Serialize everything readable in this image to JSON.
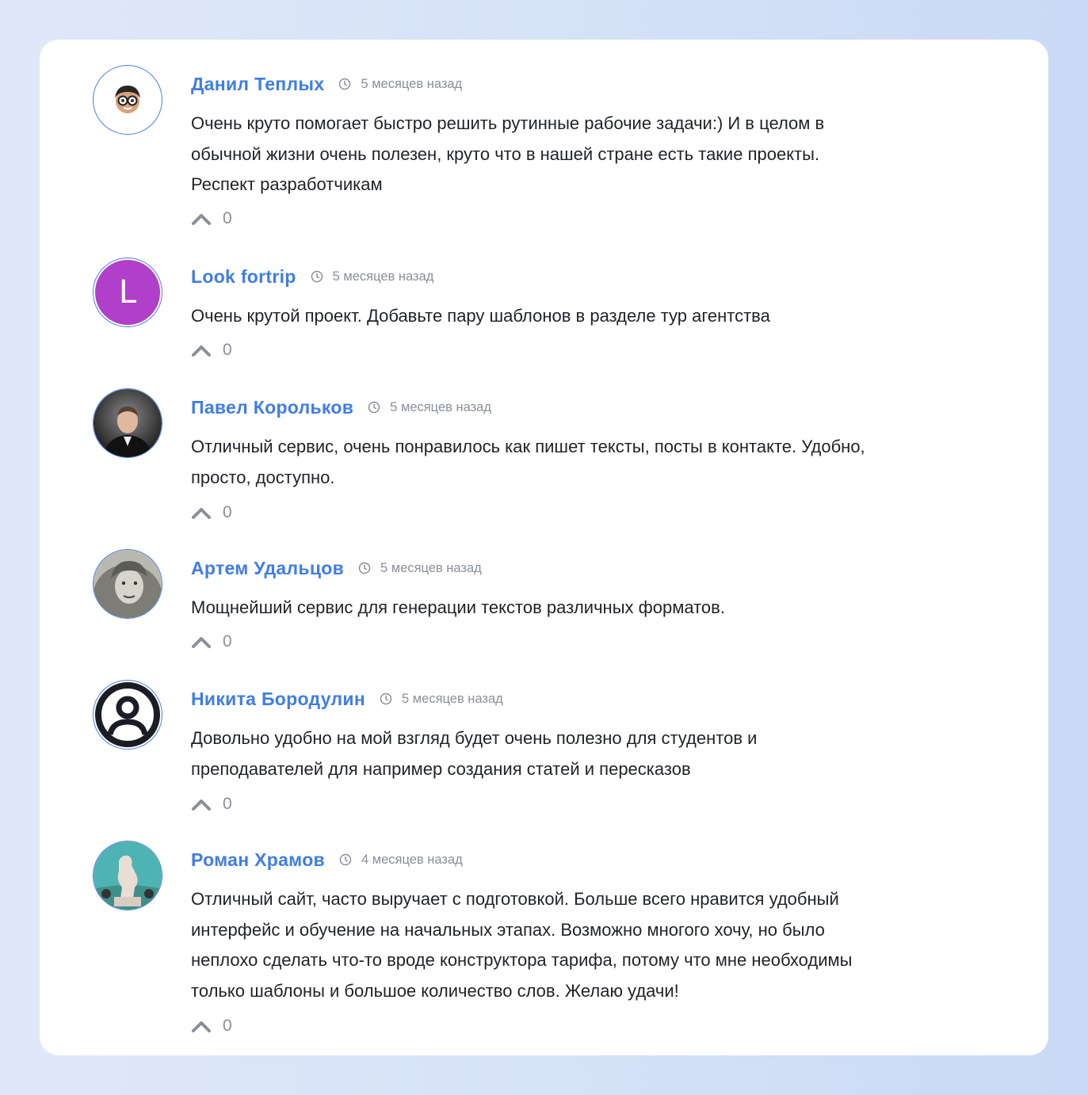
{
  "comments": [
    {
      "author": "Данил Теплых",
      "time": "5 месяцев назад",
      "text": "Очень круто помогает быстро решить рутинные рабочие задачи:) И в целом в\nобычной жизни очень полезен, круто что в нашей стране есть такие проекты.\nРеспект разработчикам",
      "votes": "0",
      "avatar": "memoji-avatar"
    },
    {
      "author": "Look fortrip",
      "time": "5 месяцев назад",
      "text": "Очень крутой проект. Добавьте пару шаблонов в разделе тур агентства",
      "votes": "0",
      "avatar": "letter-avatar",
      "avatar_letter": "L",
      "avatar_color": "#b03fc9"
    },
    {
      "author": "Павел Корольков",
      "time": "5 месяцев назад",
      "text": "Отличный сервис, очень понравилось как пишет тексты, посты в контакте. Удобно,\nпросто, доступно.",
      "votes": "0",
      "avatar": "photo-avatar"
    },
    {
      "author": "Артем Удальцов",
      "time": "5 месяцев назад",
      "text": "Мощнейший сервис для генерации текстов различных форматов.",
      "votes": "0",
      "avatar": "portrait-avatar"
    },
    {
      "author": "Никита Бородулин",
      "time": "5 месяцев назад",
      "text": "Довольно удобно на мой взгляд будет очень полезно для студентов и\nпреподавателей для например создания статей и пересказов",
      "votes": "0",
      "avatar": "user-icon-avatar"
    },
    {
      "author": "Роман Храмов",
      "time": "4 месяцев назад",
      "text": "Отличный сайт, часто выручает с подготовкой. Больше всего нравится удобный\nинтерфейс и обучение на начальных этапах. Возможно многого хочу, но было\nнеплохо сделать что-то вроде конструктора тарифа, потому что мне необходимы\nтолько шаблоны и большое количество слов. Желаю удачи!",
      "votes": "0",
      "avatar": "statue-avatar"
    }
  ],
  "colors": {
    "author": "#3f7de6",
    "meta": "#8a8f98",
    "text": "#1f2328",
    "card": "#ffffff"
  },
  "icons": {
    "time": "clock-icon",
    "upvote": "chevron-up-icon"
  }
}
